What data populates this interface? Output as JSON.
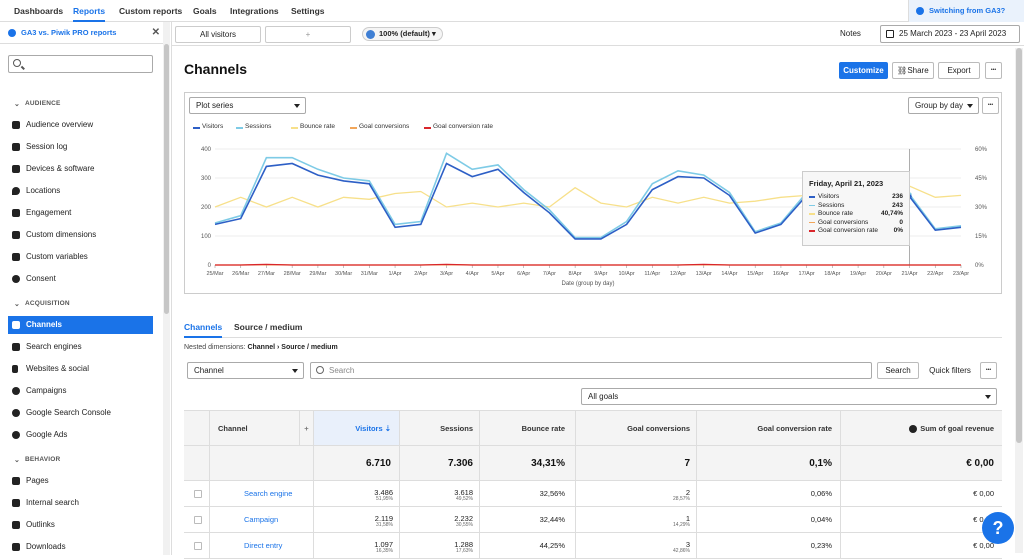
{
  "topnav": {
    "tabs": [
      "Dashboards",
      "Reports",
      "Custom reports",
      "Goals",
      "Integrations",
      "Settings"
    ],
    "active": "Reports",
    "switch_label": "Switching from GA3?"
  },
  "sidebar": {
    "dashboard_label": "GA3 vs. Piwik PRO reports",
    "sections": {
      "audience": "AUDIENCE",
      "acquisition": "ACQUISITION",
      "behavior": "BEHAVIOR"
    },
    "audience_items": [
      "Audience overview",
      "Session log",
      "Devices & software",
      "Locations",
      "Engagement",
      "Custom dimensions",
      "Custom variables",
      "Consent"
    ],
    "acquisition_items": [
      "Channels",
      "Search engines",
      "Websites & social",
      "Campaigns",
      "Google Search Console",
      "Google Ads"
    ],
    "behavior_items": [
      "Pages",
      "Internal search",
      "Outlinks",
      "Downloads"
    ],
    "active_item": "Channels"
  },
  "toolbar": {
    "segment": "All visitors",
    "add_segment": "+",
    "sampling": "100% (default)",
    "notes": "Notes",
    "date_range": "25 March 2023 - 23 April 2023"
  },
  "page": {
    "title": "Channels",
    "customize": "Customize",
    "share": "Share",
    "export": "Export",
    "more": "•••"
  },
  "chart_controls": {
    "plot_series": "Plot series",
    "group_by": "Group by day",
    "more": "•••"
  },
  "colors": {
    "accent": "#1a73e8",
    "visitors": "#2d5fc6",
    "sessions": "#7ecbe6",
    "bounce_rate": "#f7e08a",
    "goal_conversions": "#f2a65a",
    "goal_conversion_rate": "#d9262b"
  },
  "chart_data": {
    "type": "line",
    "x": [
      "25/Mar",
      "26/Mar",
      "27/Mar",
      "28/Mar",
      "29/Mar",
      "30/Mar",
      "31/Mar",
      "1/Apr",
      "2/Apr",
      "3/Apr",
      "4/Apr",
      "5/Apr",
      "6/Apr",
      "7/Apr",
      "8/Apr",
      "9/Apr",
      "10/Apr",
      "11/Apr",
      "12/Apr",
      "13/Apr",
      "14/Apr",
      "15/Apr",
      "16/Apr",
      "17/Apr",
      "18/Apr",
      "19/Apr",
      "20/Apr",
      "21/Apr",
      "22/Apr",
      "23/Apr"
    ],
    "xlabel": "Date (group by day)",
    "yleft_ticks": [
      "0",
      "100",
      "200",
      "300",
      "400"
    ],
    "yright_ticks": [
      "0%",
      "15%",
      "30%",
      "45%",
      "60%"
    ],
    "ylim_left": [
      0,
      400
    ],
    "ylim_right": [
      0,
      60
    ],
    "series": [
      {
        "name": "Visitors",
        "axis": "left",
        "values": [
          140,
          160,
          340,
          350,
          310,
          290,
          280,
          130,
          140,
          350,
          305,
          330,
          250,
          180,
          90,
          90,
          140,
          260,
          305,
          300,
          240,
          110,
          140,
          240,
          220,
          230,
          225,
          236,
          120,
          130
        ]
      },
      {
        "name": "Sessions",
        "axis": "left",
        "values": [
          145,
          170,
          370,
          370,
          330,
          300,
          290,
          140,
          150,
          385,
          330,
          345,
          260,
          190,
          95,
          95,
          150,
          280,
          325,
          310,
          250,
          115,
          145,
          250,
          230,
          240,
          235,
          243,
          125,
          135
        ]
      },
      {
        "name": "Bounce rate",
        "axis": "right",
        "values": [
          30,
          35,
          30,
          35,
          30,
          35,
          34,
          37,
          38,
          30,
          32,
          30,
          32,
          30,
          40,
          32,
          30,
          35,
          32,
          35,
          32,
          33,
          35,
          36,
          35,
          37,
          40,
          40.74,
          35,
          36
        ]
      },
      {
        "name": "Goal conversions",
        "axis": "left",
        "values": [
          0,
          0,
          1,
          0,
          0,
          0,
          0,
          0,
          0,
          1,
          0,
          0,
          0,
          0,
          0,
          0,
          0,
          0,
          0,
          1,
          0,
          0,
          0,
          0,
          0,
          0,
          0,
          0,
          0,
          0
        ]
      },
      {
        "name": "Goal conversion rate",
        "axis": "right",
        "values": [
          0,
          0,
          0.3,
          0,
          0,
          0,
          0,
          0,
          0,
          0.3,
          0,
          0,
          0,
          0,
          0,
          0,
          0,
          0,
          0,
          0.3,
          0,
          0,
          0,
          0,
          0,
          0,
          0,
          0,
          0,
          0
        ]
      }
    ],
    "legend_placement": "top-left",
    "grid": true
  },
  "tooltip": {
    "title": "Friday, April 21, 2023",
    "rows": [
      {
        "label": "Visitors",
        "value": "236"
      },
      {
        "label": "Sessions",
        "value": "243"
      },
      {
        "label": "Bounce rate",
        "value": "40,74%"
      },
      {
        "label": "Goal conversions",
        "value": "0"
      },
      {
        "label": "Goal conversion rate",
        "value": "0%"
      }
    ]
  },
  "report_tabs": [
    "Channels",
    "Source / medium"
  ],
  "nested": {
    "prefix": "Nested dimensions:",
    "path": "Channel › Source / medium"
  },
  "table_controls": {
    "dimension": "Channel",
    "search_placeholder": "Search",
    "search_button": "Search",
    "quick_filters": "Quick filters",
    "more": "•••",
    "goal_select": "All goals"
  },
  "table": {
    "headers": {
      "channel": "Channel",
      "add": "+",
      "visitors": "Visitors",
      "sessions": "Sessions",
      "bounce_rate": "Bounce rate",
      "goal_conversions": "Goal conversions",
      "goal_conversion_rate": "Goal conversion rate",
      "revenue": "Sum of goal revenue"
    },
    "totals": {
      "visitors": "6.710",
      "sessions": "7.306",
      "bounce_rate": "34,31%",
      "goal_conversions": "7",
      "goal_conversion_rate": "0,1%",
      "revenue": "€ 0,00"
    },
    "rows": [
      {
        "channel": "Search engine",
        "visitors": "3.486",
        "visitors_pct": "51,95%",
        "sessions": "3.618",
        "sessions_pct": "49,52%",
        "bounce_rate": "32,56%",
        "goal_conversions": "2",
        "goal_conversions_pct": "28,57%",
        "goal_conversion_rate": "0,06%",
        "revenue": "€ 0,00"
      },
      {
        "channel": "Campaign",
        "visitors": "2.119",
        "visitors_pct": "31,58%",
        "sessions": "2.232",
        "sessions_pct": "30,55%",
        "bounce_rate": "32,44%",
        "goal_conversions": "1",
        "goal_conversions_pct": "14,29%",
        "goal_conversion_rate": "0,04%",
        "revenue": "€ 0,00"
      },
      {
        "channel": "Direct entry",
        "visitors": "1.097",
        "visitors_pct": "16,35%",
        "sessions": "1.288",
        "sessions_pct": "17,63%",
        "bounce_rate": "44,25%",
        "goal_conversions": "3",
        "goal_conversions_pct": "42,86%",
        "goal_conversion_rate": "0,23%",
        "revenue": "€ 0,00"
      }
    ]
  },
  "help": "?"
}
